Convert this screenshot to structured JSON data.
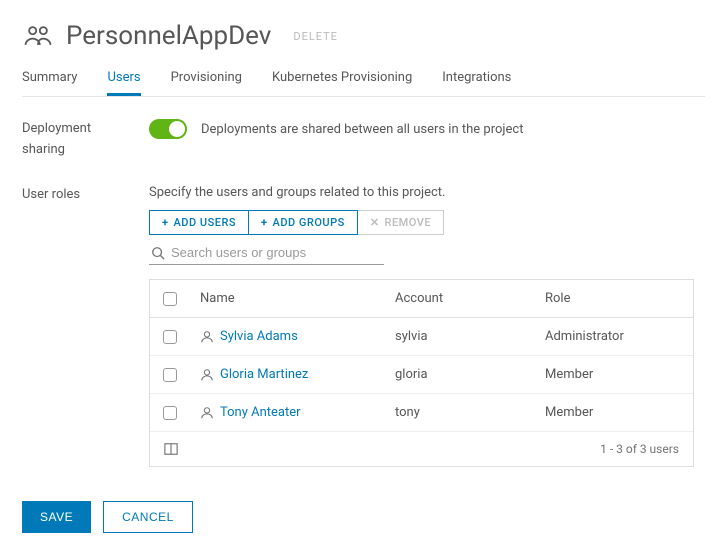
{
  "header": {
    "title": "PersonnelAppDev",
    "delete_label": "DELETE"
  },
  "tabs": {
    "summary": "Summary",
    "users": "Users",
    "provisioning": "Provisioning",
    "k8s": "Kubernetes Provisioning",
    "integrations": "Integrations"
  },
  "deployment": {
    "label_line1": "Deployment",
    "label_line2": "sharing",
    "text": "Deployments are shared between all users in the project"
  },
  "user_roles": {
    "label": "User roles",
    "description": "Specify the users and groups related to this project.",
    "add_users": "ADD USERS",
    "add_groups": "ADD GROUPS",
    "remove": "REMOVE",
    "search_placeholder": "Search users or groups"
  },
  "table": {
    "head": {
      "name": "Name",
      "account": "Account",
      "role": "Role"
    },
    "rows": [
      {
        "name": "Sylvia Adams",
        "account": "sylvia",
        "role": "Administrator"
      },
      {
        "name": "Gloria Martinez",
        "account": "gloria",
        "role": "Member"
      },
      {
        "name": "Tony Anteater",
        "account": "tony",
        "role": "Member"
      }
    ],
    "pager": "1 - 3 of 3 users"
  },
  "footer": {
    "save": "SAVE",
    "cancel": "CANCEL"
  }
}
